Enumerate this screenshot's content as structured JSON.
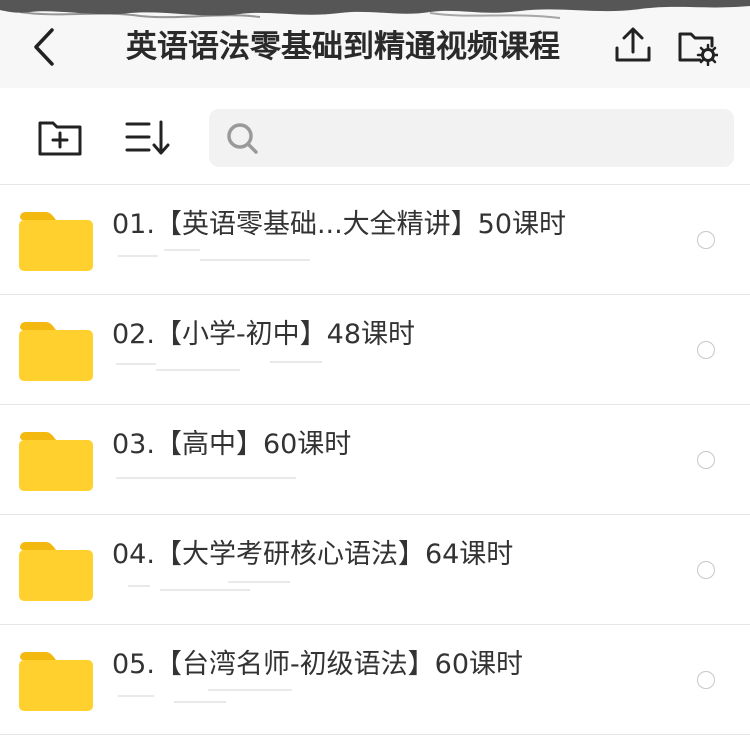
{
  "header": {
    "title": "英语语法零基础到精通视频课程",
    "icons": {
      "back": "chevron-left-icon",
      "upload": "upload-icon",
      "folder_settings": "folder-gear-icon"
    }
  },
  "toolbar": {
    "icons": {
      "new_folder": "folder-plus-icon",
      "sort": "sort-icon",
      "search": "search-icon"
    },
    "search_value": ""
  },
  "file_list": {
    "items": [
      {
        "title": "01.【英语零基础...大全精讲】50课时"
      },
      {
        "title": "02.【小学-初中】48课时"
      },
      {
        "title": "03.【高中】60课时"
      },
      {
        "title": "04.【大学考研核心语法】64课时"
      },
      {
        "title": "05.【台湾名师-初级语法】60课时"
      }
    ],
    "folder_color": "#FFD02E",
    "folder_tab_color": "#F3B911"
  },
  "colors": {
    "header_bg": "#f7f7f7",
    "search_bg": "#f2f2f2",
    "divider": "#e6e6e6",
    "icon_stroke": "#222222"
  }
}
